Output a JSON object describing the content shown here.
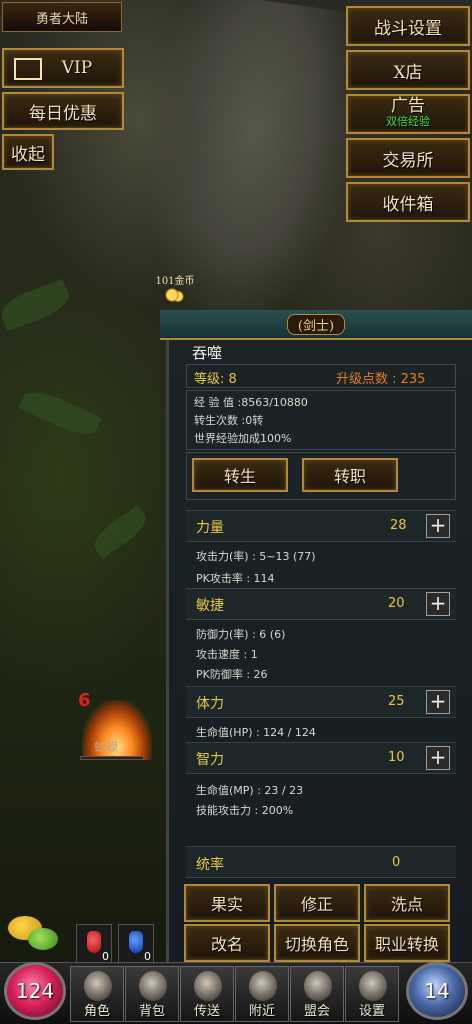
{
  "top_left": {
    "region": "勇者大陆",
    "vip_label": "VIP",
    "daily_label": "每日优惠",
    "collapse_label": "收起"
  },
  "top_right": {
    "battle_settings": "战斗设置",
    "x_shop": "X店",
    "ad_label": "广告",
    "ad_sub": "双倍经验",
    "exchange": "交易所",
    "mailbox": "收件箱"
  },
  "ground": {
    "gold_drop": "101金币"
  },
  "monster": {
    "level": "6",
    "name": "蛤蟆"
  },
  "panel": {
    "title": "(剑士)",
    "name": "吞噬",
    "level_label": "等级: 8",
    "upgrade_points_label": "升级点数 : 235",
    "exp": "经 验 值 :8563/10880",
    "rebirth_count": "转生次数 :0转",
    "world_exp_bonus": "世界经验加成100%",
    "rebirth_btn": "转生",
    "change_job_btn": "转职",
    "attributes": [
      {
        "label": "力量",
        "value": "28",
        "details": [
          "攻击力(率) : 5~13 (77)",
          "PK攻击率 : 114"
        ]
      },
      {
        "label": "敏捷",
        "value": "20",
        "details": [
          "防御力(率) : 6 (6)",
          "攻击速度 : 1",
          "PK防御率 : 26"
        ]
      },
      {
        "label": "体力",
        "value": "25",
        "details": [
          "生命值(HP) : 124 / 124"
        ]
      },
      {
        "label": "智力",
        "value": "10",
        "details": [
          "生命值(MP) : 23 / 23",
          "技能攻击力 : 200%"
        ]
      }
    ],
    "leadership_label": "统率",
    "leadership_value": "0",
    "actions": [
      "果实",
      "修正",
      "洗点",
      "改名",
      "切换角色",
      "职业转换"
    ]
  },
  "bottom": {
    "hp_orb": "124",
    "mp_orb": "14",
    "potions": [
      "0",
      "0"
    ],
    "nav": [
      "角色",
      "背包",
      "传送",
      "附近",
      "盟会",
      "设置"
    ]
  },
  "colors": {
    "gold_border": "#b08a3a",
    "attr_yellow": "#e8c740",
    "points_orange": "#e87a20"
  }
}
